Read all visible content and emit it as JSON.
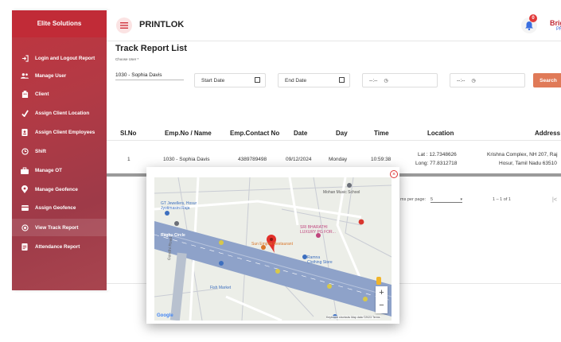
{
  "sidebar": {
    "brand": "Elite Solutions",
    "items": [
      {
        "label": "Login and Logout Report",
        "icon": "login-icon"
      },
      {
        "label": "Manage User",
        "icon": "users-icon"
      },
      {
        "label": "Client",
        "icon": "building-icon"
      },
      {
        "label": "Assign Client Location",
        "icon": "location-check-icon"
      },
      {
        "label": "Assign Client Employees",
        "icon": "badge-icon"
      },
      {
        "label": "Shift",
        "icon": "clock-icon"
      },
      {
        "label": "Manage OT",
        "icon": "briefcase-icon"
      },
      {
        "label": "Manage Geofence",
        "icon": "pin-icon"
      },
      {
        "label": "Assign Geofence",
        "icon": "card-icon"
      },
      {
        "label": "View Track Report",
        "icon": "track-icon"
      },
      {
        "label": "Attendance Report",
        "icon": "report-icon"
      }
    ],
    "active_index": 9
  },
  "header": {
    "title": "PRINTLOK",
    "notification_count": "0",
    "user_name": "Brig",
    "user_role": "PF"
  },
  "page": {
    "title": "Track Report List",
    "filter_label": "Choose User *",
    "selected_user": "1030 - Sophia Davis",
    "start_date": "Start Date",
    "end_date": "End Date",
    "time_from": "--:--",
    "time_to": "--:--",
    "search_label": "Search"
  },
  "table": {
    "headers": [
      "Sl.No",
      "Emp.No / Name",
      "Emp.Contact No",
      "Date",
      "Day",
      "Time",
      "Location",
      "Address"
    ],
    "rows": [
      {
        "sl": "1",
        "emp": "1030 - Sophia Davis",
        "contact": "4389789498",
        "date": "09/12/2024",
        "day": "Monday",
        "time": "10:59:38",
        "lat": "Lat : 12.7348626",
        "long": "Long: 77.8312718",
        "address1": "Krishna Complex, NH 207, Raj",
        "address2": "Hosur, Tamil Nadu 63510"
      }
    ]
  },
  "pagination": {
    "items_label": "ms per page:",
    "items_value": "5",
    "range": "1 – 1 of 1",
    "first": "|<"
  },
  "map": {
    "labels": [
      {
        "text": "Mohan Music School",
        "color": "#555"
      },
      {
        "text": "SRI BHARATHI",
        "color": "#c0457e"
      },
      {
        "text": "LUXURY PG FOR...",
        "color": "#c0457e"
      },
      {
        "text": "Sun Empire Restaurant",
        "color": "#d9772a"
      },
      {
        "text": "Ramna",
        "color": "#3d6fbf"
      },
      {
        "text": "Clothing Store",
        "color": "#3d6fbf"
      },
      {
        "text": "Fish Market",
        "color": "#3d6fbf"
      },
      {
        "text": "GT Jewellers, Hosur",
        "color": "#3d6fbf"
      },
      {
        "text": "Jyotimasini Raja",
        "color": "#3d6fbf"
      },
      {
        "text": "Raghu Circle",
        "color": "#fff"
      },
      {
        "text": "Gandhi Road",
        "color": "#666"
      }
    ],
    "zoom_in": "+",
    "zoom_out": "−",
    "brand": "Google",
    "attribution": "Keyboard shortcuts   Map data ©2023   Terms",
    "close": "×"
  }
}
